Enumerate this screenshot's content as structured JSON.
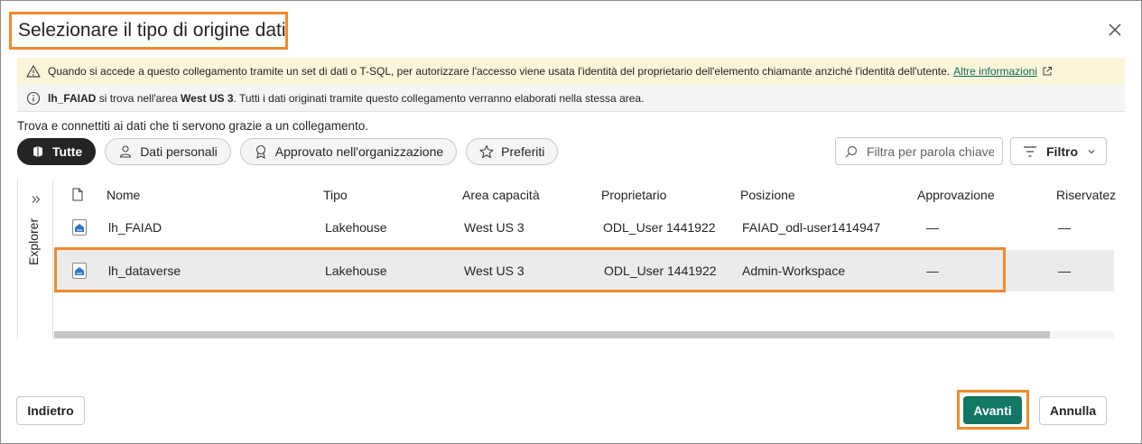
{
  "dialog": {
    "title": "Selezionare il tipo di origine dati",
    "close_icon": "close-icon"
  },
  "warning_banner": {
    "icon": "warning-icon",
    "text": "Quando si accede a questo collegamento tramite un set di dati o T-SQL, per autorizzare l'accesso viene usata l'identità del proprietario dell'elemento chiamante anziché l'identità dell'utente.",
    "link_label": "Altre informazioni",
    "link_icon": "external-link-icon"
  },
  "info_banner": {
    "icon": "info-icon",
    "name": "lh_FAIAD",
    "text_before": "si trova nell'area",
    "region": "West US 3",
    "text_after": ". Tutti i dati originati tramite questo collegamento verranno elaborati nella stessa area."
  },
  "subtitle": "Trova e connettiti ai dati che ti servono grazie a un collegamento.",
  "filters": [
    {
      "label": "Tutte",
      "icon": "all-items-icon",
      "active": true
    },
    {
      "label": "Dati personali",
      "icon": "person-icon",
      "active": false
    },
    {
      "label": "Approvato nell'organizzazione",
      "icon": "ribbon-icon",
      "active": false
    },
    {
      "label": "Preferiti",
      "icon": "star-icon",
      "active": false
    }
  ],
  "search": {
    "placeholder": "Filtra per parola chiave",
    "value": ""
  },
  "filter_button": {
    "label": "Filtro"
  },
  "explorer": {
    "label": "Explorer"
  },
  "table": {
    "columns": [
      "Nome",
      "Tipo",
      "Area capacità",
      "Proprietario",
      "Posizione",
      "Approvazione",
      "Riservatez"
    ],
    "rows": [
      {
        "name": "lh_FAIAD",
        "type": "Lakehouse",
        "area": "West US 3",
        "owner": "ODL_User 1441922",
        "location": "FAIAD_odl-user1414947",
        "approval": "—",
        "sensitivity": "—",
        "selected": false
      },
      {
        "name": "lh_dataverse",
        "type": "Lakehouse",
        "area": "West US 3",
        "owner": "ODL_User 1441922",
        "location": "Admin-Workspace",
        "approval": "—",
        "sensitivity": "—",
        "selected": true
      }
    ]
  },
  "footer": {
    "back_label": "Indietro",
    "next_label": "Avanti",
    "cancel_label": "Annulla"
  },
  "colors": {
    "accent_green": "#117865",
    "highlight_orange": "#f08a30",
    "warning_bg": "#fbf6d9"
  }
}
